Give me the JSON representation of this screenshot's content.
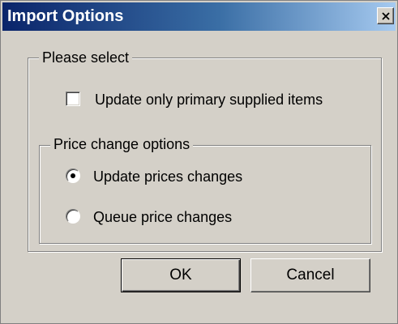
{
  "dialog": {
    "title": "Import Options",
    "close_icon": "close-icon"
  },
  "group_select": {
    "label": "Please select",
    "checkbox": {
      "label": "Update only primary supplied items",
      "checked": false
    }
  },
  "group_price": {
    "label": "Price change options",
    "options": [
      {
        "label": "Update prices changes",
        "selected": true
      },
      {
        "label": "Queue price changes",
        "selected": false
      }
    ]
  },
  "buttons": {
    "ok_label": "OK",
    "cancel_label": "Cancel"
  },
  "colors": {
    "face": "#d4d0c8",
    "title_start": "#0a246a",
    "title_end": "#a6caf0"
  }
}
